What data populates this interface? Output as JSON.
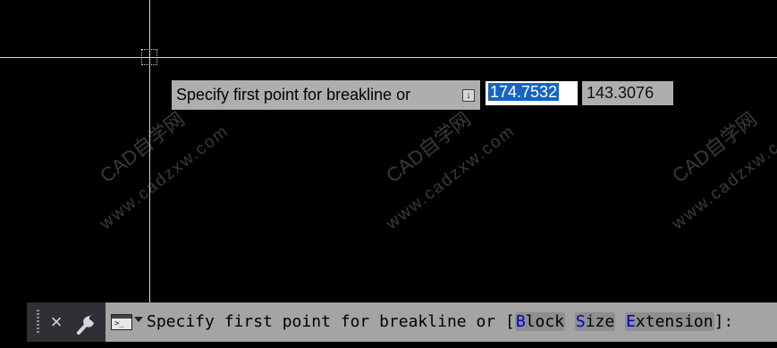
{
  "dynamic_input": {
    "prompt": "Specify first point for breakline or",
    "options_arrow": "↓",
    "x_value": "174.7532",
    "y_value": "143.3076"
  },
  "watermarks": {
    "brand": "CAD自学网",
    "site": "www.cadzxw.com"
  },
  "command_line": {
    "prompt": "Specify first point for breakline or [",
    "options": [
      {
        "key": "B",
        "rest": "lock"
      },
      {
        "key": "S",
        "rest": "ize"
      },
      {
        "key": "E",
        "rest": "xtension"
      }
    ],
    "suffix": "]:",
    "close_icon": "×",
    "icons": [
      "close-icon",
      "wrench-icon",
      "command-window-icon",
      "chevron-down-icon"
    ]
  }
}
